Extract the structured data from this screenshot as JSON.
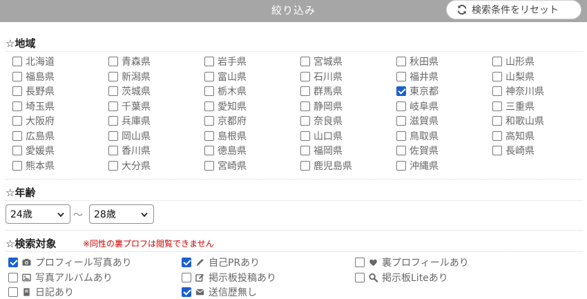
{
  "header": {
    "title": "絞り込み",
    "reset_label": "検索条件をリセット"
  },
  "region": {
    "title": "地域",
    "prefectures": [
      {
        "label": "北海道",
        "checked": false
      },
      {
        "label": "青森県",
        "checked": false
      },
      {
        "label": "岩手県",
        "checked": false
      },
      {
        "label": "宮城県",
        "checked": false
      },
      {
        "label": "秋田県",
        "checked": false
      },
      {
        "label": "山形県",
        "checked": false
      },
      {
        "label": "福島県",
        "checked": false
      },
      {
        "label": "新潟県",
        "checked": false
      },
      {
        "label": "富山県",
        "checked": false
      },
      {
        "label": "石川県",
        "checked": false
      },
      {
        "label": "福井県",
        "checked": false
      },
      {
        "label": "山梨県",
        "checked": false
      },
      {
        "label": "長野県",
        "checked": false
      },
      {
        "label": "茨城県",
        "checked": false
      },
      {
        "label": "栃木県",
        "checked": false
      },
      {
        "label": "群馬県",
        "checked": false
      },
      {
        "label": "東京都",
        "checked": true
      },
      {
        "label": "神奈川県",
        "checked": false
      },
      {
        "label": "埼玉県",
        "checked": false
      },
      {
        "label": "千葉県",
        "checked": false
      },
      {
        "label": "愛知県",
        "checked": false
      },
      {
        "label": "静岡県",
        "checked": false
      },
      {
        "label": "岐阜県",
        "checked": false
      },
      {
        "label": "三重県",
        "checked": false
      },
      {
        "label": "大阪府",
        "checked": false
      },
      {
        "label": "兵庫県",
        "checked": false
      },
      {
        "label": "京都府",
        "checked": false
      },
      {
        "label": "奈良県",
        "checked": false
      },
      {
        "label": "滋賀県",
        "checked": false
      },
      {
        "label": "和歌山県",
        "checked": false
      },
      {
        "label": "広島県",
        "checked": false
      },
      {
        "label": "岡山県",
        "checked": false
      },
      {
        "label": "島根県",
        "checked": false
      },
      {
        "label": "山口県",
        "checked": false
      },
      {
        "label": "鳥取県",
        "checked": false
      },
      {
        "label": "高知県",
        "checked": false
      },
      {
        "label": "愛媛県",
        "checked": false
      },
      {
        "label": "香川県",
        "checked": false
      },
      {
        "label": "徳島県",
        "checked": false
      },
      {
        "label": "福岡県",
        "checked": false
      },
      {
        "label": "佐賀県",
        "checked": false
      },
      {
        "label": "長崎県",
        "checked": false
      },
      {
        "label": "熊本県",
        "checked": false
      },
      {
        "label": "大分県",
        "checked": false
      },
      {
        "label": "宮崎県",
        "checked": false
      },
      {
        "label": "鹿児島県",
        "checked": false
      },
      {
        "label": "沖縄県",
        "checked": false
      }
    ]
  },
  "age": {
    "title": "年齢",
    "min": "24歳",
    "separator": "～",
    "max": "28歳"
  },
  "search_target": {
    "title": "検索対象",
    "warning": "※同性の裏プロフは閲覧できません",
    "options": [
      {
        "label": "プロフィール写真あり",
        "checked": true,
        "icon": "camera-icon"
      },
      {
        "label": "自己PRあり",
        "checked": true,
        "icon": "pencil-icon"
      },
      {
        "label": "裏プロフィールあり",
        "checked": false,
        "icon": "heart-icon"
      },
      {
        "label": "写真アルバムあり",
        "checked": false,
        "icon": "image-icon"
      },
      {
        "label": "掲示板投稿あり",
        "checked": false,
        "icon": "edit-icon"
      },
      {
        "label": "掲示板Liteあり",
        "checked": false,
        "icon": "search-icon"
      },
      {
        "label": "日記あり",
        "checked": false,
        "icon": "book-icon"
      },
      {
        "label": "送信歴無し",
        "checked": true,
        "icon": "envelope-icon"
      }
    ]
  }
}
